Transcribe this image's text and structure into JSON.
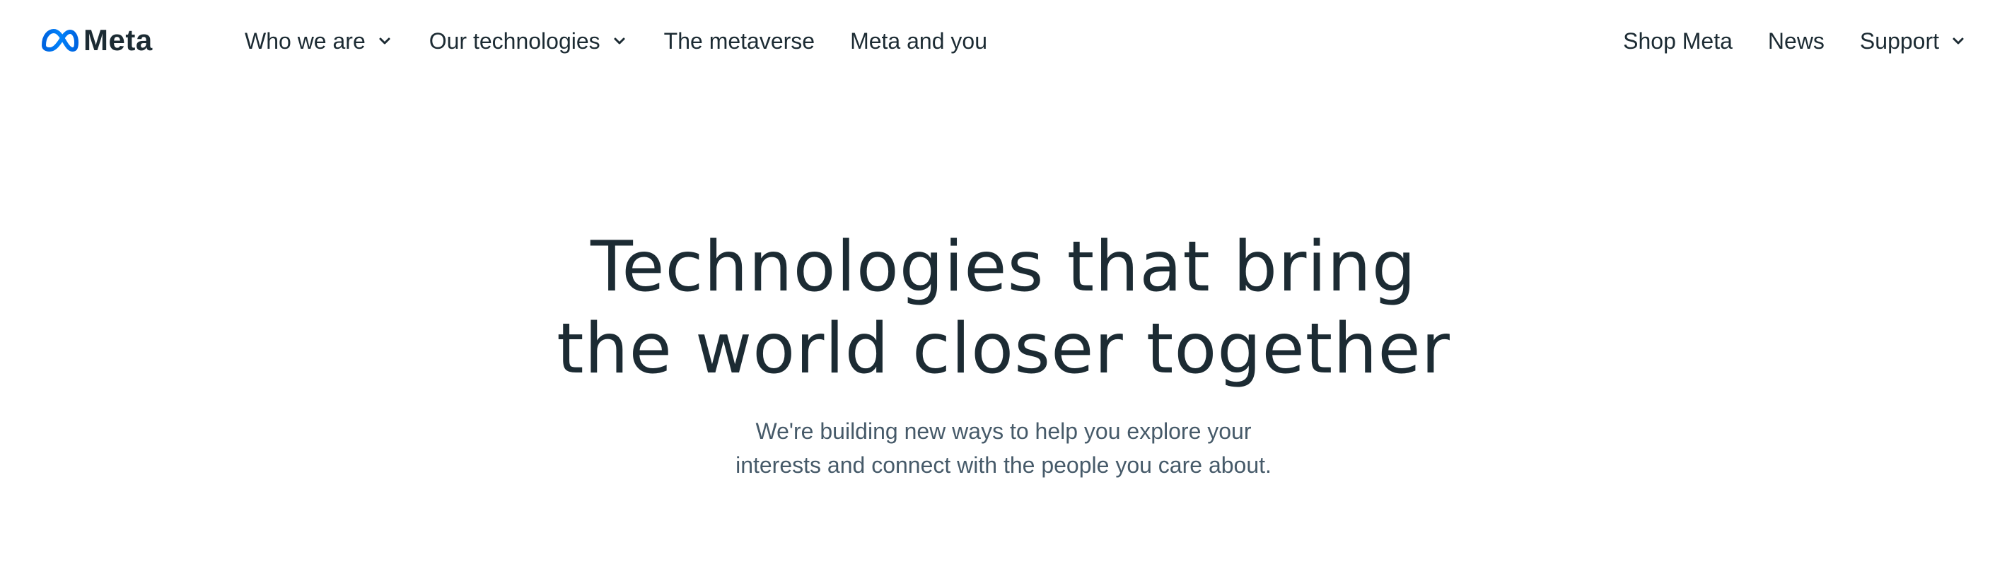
{
  "brand": {
    "logo_icon": "meta-infinity-icon",
    "name": "Meta",
    "logo_color": "#0866ff"
  },
  "nav_left": [
    {
      "label": "Who we are",
      "has_dropdown": true
    },
    {
      "label": "Our technologies",
      "has_dropdown": true
    },
    {
      "label": "The metaverse",
      "has_dropdown": false
    },
    {
      "label": "Meta and you",
      "has_dropdown": false
    }
  ],
  "nav_right": [
    {
      "label": "Shop Meta",
      "has_dropdown": false
    },
    {
      "label": "News",
      "has_dropdown": false
    },
    {
      "label": "Support",
      "has_dropdown": true
    }
  ],
  "hero": {
    "title_line1": "Technologies that bring",
    "title_line2": "the world closer together",
    "subtitle_line1": "We're building new ways to help you explore your",
    "subtitle_line2": "interests and connect with the people you care about."
  },
  "colors": {
    "text_primary": "#1c2b33",
    "text_secondary": "#465a69",
    "background": "#ffffff"
  }
}
